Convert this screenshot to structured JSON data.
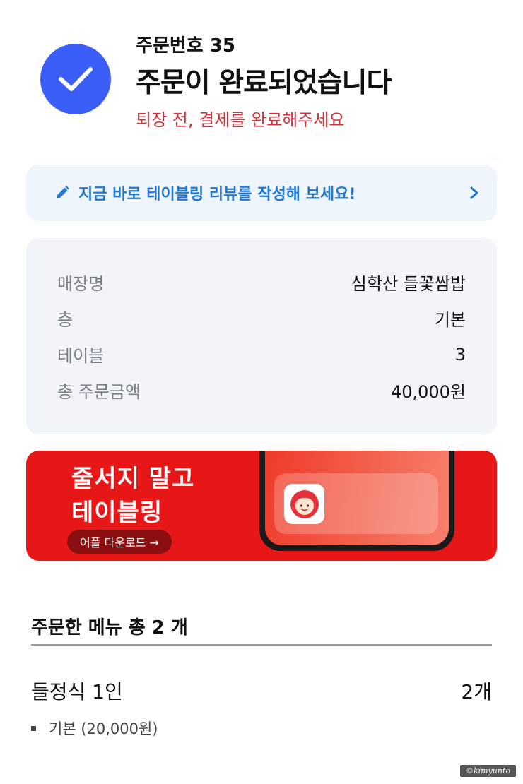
{
  "header": {
    "order_number": "주문번호 35",
    "title": "주문이 완료되었습니다",
    "notice": "퇴장 전, 결제를 완료해주세요"
  },
  "review_banner": {
    "icon": "pencil-icon",
    "text": "지금 바로 테이블링 리뷰를 작성해 보세요!",
    "chevron": "chevron-right-icon"
  },
  "order_info": {
    "rows": [
      {
        "label": "매장명",
        "value": "심학산 들꽃쌈밥"
      },
      {
        "label": "층",
        "value": "기본"
      },
      {
        "label": "테이블",
        "value": "3"
      },
      {
        "label": "총 주문금액",
        "value": "40,000원"
      }
    ]
  },
  "promo": {
    "line1": "줄서지 말고",
    "line2": "테이블링",
    "button": "어플 다운로드 →"
  },
  "menu": {
    "heading": "주문한 메뉴 총 2 개",
    "items": [
      {
        "name": "들정식 1인",
        "qty": "2개",
        "option": "기본 (20,000원)"
      }
    ]
  },
  "watermark": "©kimyunto",
  "colors": {
    "accent_blue": "#3a5ef7",
    "notice_red": "#d0343a",
    "review_blue": "#2378d3",
    "promo_red": "#e81717"
  }
}
